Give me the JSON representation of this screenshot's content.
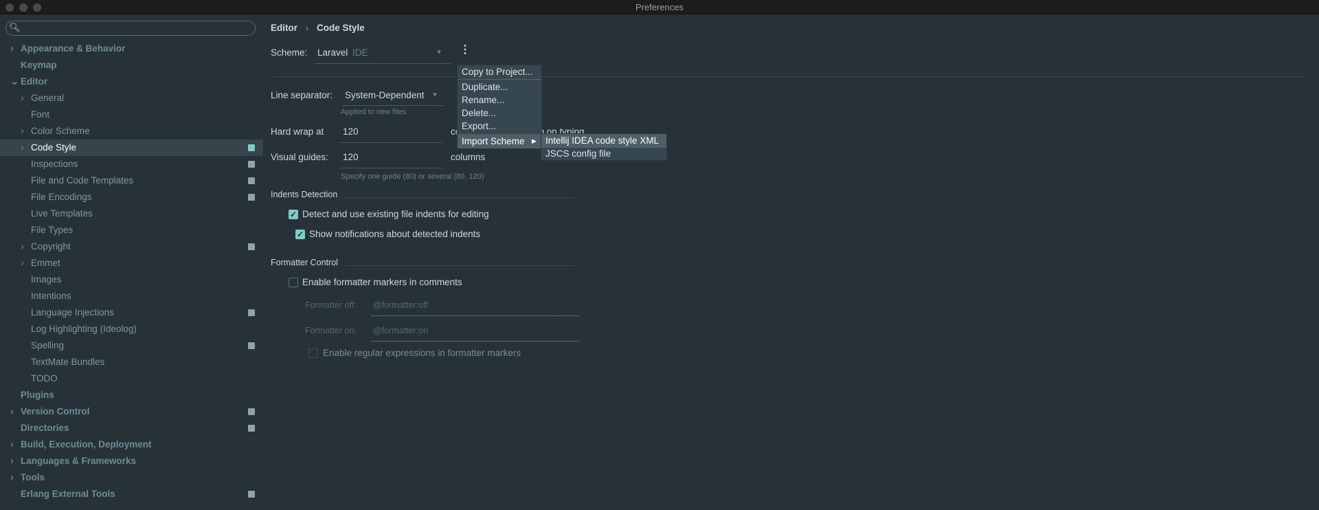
{
  "window": {
    "title": "Preferences"
  },
  "search": {
    "placeholder": ""
  },
  "sidebar": {
    "items": [
      {
        "label": "Appearance & Behavior",
        "level": 0,
        "expandable": true,
        "badge": false
      },
      {
        "label": "Keymap",
        "level": 0,
        "expandable": false,
        "badge": false
      },
      {
        "label": "Editor",
        "level": 0,
        "expandable": true,
        "expanded": true,
        "badge": false
      },
      {
        "label": "General",
        "level": 1,
        "expandable": true,
        "badge": false
      },
      {
        "label": "Font",
        "level": 1,
        "expandable": false,
        "badge": false
      },
      {
        "label": "Color Scheme",
        "level": 1,
        "expandable": true,
        "badge": false
      },
      {
        "label": "Code Style",
        "level": 1,
        "expandable": true,
        "badge": true,
        "selected": true
      },
      {
        "label": "Inspections",
        "level": 1,
        "expandable": false,
        "badge": true
      },
      {
        "label": "File and Code Templates",
        "level": 1,
        "expandable": false,
        "badge": true
      },
      {
        "label": "File Encodings",
        "level": 1,
        "expandable": false,
        "badge": true
      },
      {
        "label": "Live Templates",
        "level": 1,
        "expandable": false,
        "badge": false
      },
      {
        "label": "File Types",
        "level": 1,
        "expandable": false,
        "badge": false
      },
      {
        "label": "Copyright",
        "level": 1,
        "expandable": true,
        "badge": true
      },
      {
        "label": "Emmet",
        "level": 1,
        "expandable": true,
        "badge": false
      },
      {
        "label": "Images",
        "level": 1,
        "expandable": false,
        "badge": false
      },
      {
        "label": "Intentions",
        "level": 1,
        "expandable": false,
        "badge": false
      },
      {
        "label": "Language Injections",
        "level": 1,
        "expandable": false,
        "badge": true
      },
      {
        "label": "Log Highlighting (Ideolog)",
        "level": 1,
        "expandable": false,
        "badge": false
      },
      {
        "label": "Spelling",
        "level": 1,
        "expandable": false,
        "badge": true
      },
      {
        "label": "TextMate Bundles",
        "level": 1,
        "expandable": false,
        "badge": false
      },
      {
        "label": "TODO",
        "level": 1,
        "expandable": false,
        "badge": false
      },
      {
        "label": "Plugins",
        "level": 0,
        "expandable": false,
        "badge": false
      },
      {
        "label": "Version Control",
        "level": 0,
        "expandable": true,
        "badge": true
      },
      {
        "label": "Directories",
        "level": 0,
        "expandable": false,
        "badge": true
      },
      {
        "label": "Build, Execution, Deployment",
        "level": 0,
        "expandable": true,
        "badge": false
      },
      {
        "label": "Languages & Frameworks",
        "level": 0,
        "expandable": true,
        "badge": false
      },
      {
        "label": "Tools",
        "level": 0,
        "expandable": true,
        "badge": false
      },
      {
        "label": "Erlang External Tools",
        "level": 0,
        "expandable": false,
        "badge": true
      }
    ]
  },
  "breadcrumb": {
    "parent": "Editor",
    "sep": "›",
    "current": "Code Style"
  },
  "scheme": {
    "label": "Scheme:",
    "name": "Laravel",
    "scope": "IDE"
  },
  "line_separator": {
    "label": "Line separator:",
    "value": "System-Dependent",
    "hint": "Applied to new files"
  },
  "hard_wrap": {
    "label": "Hard wrap at",
    "value": "120",
    "unit": "columns",
    "wrap_on_typing": "Wrap on typing"
  },
  "visual_guides": {
    "label": "Visual guides:",
    "value": "120",
    "unit": "columns",
    "hint": "Specify one guide (80) or several (80, 120)"
  },
  "indents": {
    "title": "Indents Detection",
    "detect": "Detect and use existing file indents for editing",
    "detect_checked": true,
    "notify": "Show notifications about detected indents",
    "notify_checked": true
  },
  "formatter": {
    "title": "Formatter Control",
    "enable": "Enable formatter markers in comments",
    "enable_checked": false,
    "off_label": "Formatter off:",
    "off_value": "@formatter:off",
    "on_label": "Formatter on:",
    "on_value": "@formatter:on",
    "regex": "Enable regular expressions in formatter markers",
    "regex_checked": false
  },
  "menu": {
    "items": [
      "Copy to Project...",
      "Duplicate...",
      "Rename...",
      "Delete...",
      "Export...",
      "Import Scheme"
    ]
  },
  "submenu": {
    "items": [
      "Intellij IDEA code style XML",
      "JSCS config file"
    ]
  },
  "colors": {
    "background": "#263238",
    "accent": "#80cbc4",
    "selection": "#36454c"
  }
}
